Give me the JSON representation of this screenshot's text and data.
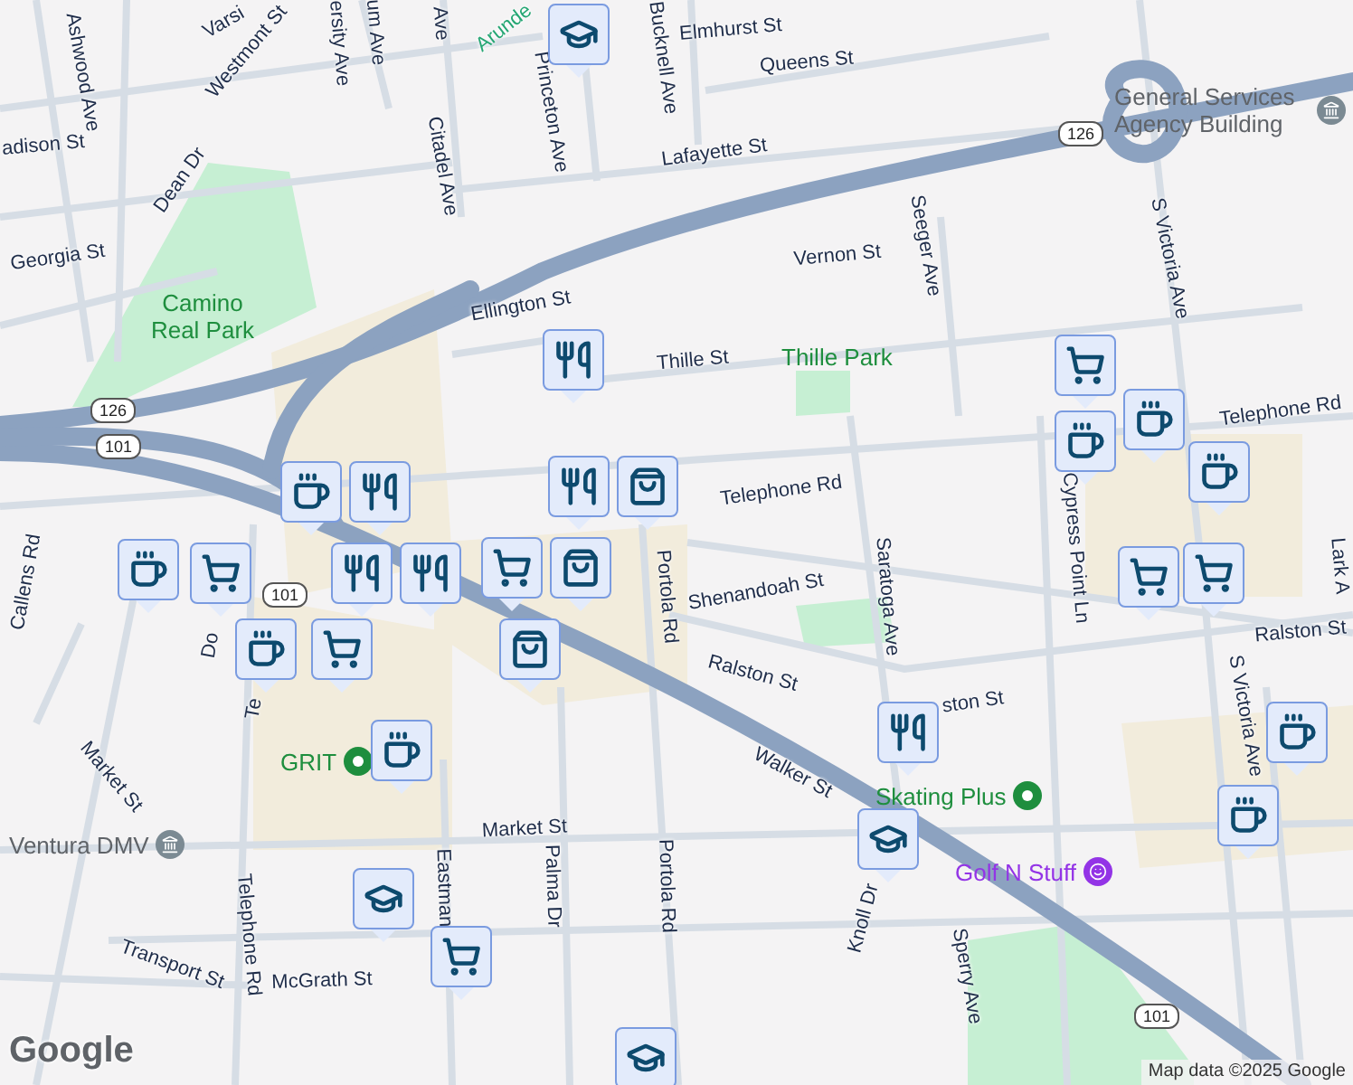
{
  "map": {
    "street_labels": [
      {
        "text": "Ashwood Ave",
        "kind": "street"
      },
      {
        "text": "Varsi",
        "kind": "street"
      },
      {
        "text": "Westmont St",
        "kind": "street"
      },
      {
        "text": "ersity Ave",
        "kind": "street"
      },
      {
        "text": "um Ave",
        "kind": "street"
      },
      {
        "text": "Ave",
        "kind": "street"
      },
      {
        "text": "Arunde",
        "kind": "trail"
      },
      {
        "text": "Princeton Ave",
        "kind": "street"
      },
      {
        "text": "Bucknell Ave",
        "kind": "street"
      },
      {
        "text": "Elmhurst St",
        "kind": "street"
      },
      {
        "text": "Queens St",
        "kind": "street"
      },
      {
        "text": "adison St",
        "kind": "street"
      },
      {
        "text": "Dean Dr",
        "kind": "street"
      },
      {
        "text": "Citadel Ave",
        "kind": "street"
      },
      {
        "text": "Lafayette St",
        "kind": "street"
      },
      {
        "text": "Georgia St",
        "kind": "street"
      },
      {
        "text": "Ellington St",
        "kind": "street"
      },
      {
        "text": "Thille St",
        "kind": "street"
      },
      {
        "text": "Vernon St",
        "kind": "street"
      },
      {
        "text": "Seeger Ave",
        "kind": "street"
      },
      {
        "text": "Telephone Rd",
        "kind": "street"
      },
      {
        "text": "Telephone Rd",
        "kind": "street"
      },
      {
        "text": "S Victoria Ave",
        "kind": "street"
      },
      {
        "text": "S Victoria Ave",
        "kind": "street"
      },
      {
        "text": "Cypress Point Ln",
        "kind": "street"
      },
      {
        "text": "Saratoga Ave",
        "kind": "street"
      },
      {
        "text": "Portola Rd",
        "kind": "street"
      },
      {
        "text": "Shenandoah St",
        "kind": "street"
      },
      {
        "text": "Ralston St",
        "kind": "street"
      },
      {
        "text": "ston St",
        "kind": "street"
      },
      {
        "text": "Ralston St",
        "kind": "street"
      },
      {
        "text": "Lark A",
        "kind": "street"
      },
      {
        "text": "Walker St",
        "kind": "street"
      },
      {
        "text": "Knoll Dr",
        "kind": "street"
      },
      {
        "text": "Sperry Ave",
        "kind": "street"
      },
      {
        "text": "Callens Rd",
        "kind": "street"
      },
      {
        "text": "Market St",
        "kind": "street"
      },
      {
        "text": "Market St",
        "kind": "street"
      },
      {
        "text": "Telephone Rd",
        "kind": "street"
      },
      {
        "text": "Te",
        "kind": "street"
      },
      {
        "text": "Do",
        "kind": "street"
      },
      {
        "text": "Eastman",
        "kind": "street"
      },
      {
        "text": "Palma Dr",
        "kind": "street"
      },
      {
        "text": "Portola Rd",
        "kind": "street"
      },
      {
        "text": "Transport St",
        "kind": "street"
      },
      {
        "text": "McGrath St",
        "kind": "street"
      }
    ],
    "places": [
      {
        "name": "Camino Real Park",
        "kind": "park"
      },
      {
        "name": "Thille Park",
        "kind": "park"
      },
      {
        "name": "General Services Agency Building",
        "kind": "civic"
      },
      {
        "name": "GRIT",
        "kind": "green-pin"
      },
      {
        "name": "Ventura DMV",
        "kind": "civic"
      },
      {
        "name": "Skating Plus",
        "kind": "green-pin"
      },
      {
        "name": "Golf N Stuff",
        "kind": "fun"
      }
    ],
    "highway_shields": [
      {
        "number": "126"
      },
      {
        "number": "101"
      },
      {
        "number": "101"
      },
      {
        "number": "126"
      },
      {
        "number": "101"
      }
    ],
    "markers": [
      {
        "kind": "school"
      },
      {
        "kind": "restaurant"
      },
      {
        "kind": "cafe"
      },
      {
        "kind": "restaurant"
      },
      {
        "kind": "cafe"
      },
      {
        "kind": "grocery"
      },
      {
        "kind": "cafe"
      },
      {
        "kind": "restaurant"
      },
      {
        "kind": "restaurant"
      },
      {
        "kind": "grocery"
      },
      {
        "kind": "restaurant"
      },
      {
        "kind": "shopping"
      },
      {
        "kind": "grocery"
      },
      {
        "kind": "shopping"
      },
      {
        "kind": "shopping"
      },
      {
        "kind": "cafe"
      },
      {
        "kind": "school"
      },
      {
        "kind": "grocery"
      },
      {
        "kind": "school"
      },
      {
        "kind": "restaurant"
      },
      {
        "kind": "school"
      },
      {
        "kind": "grocery"
      },
      {
        "kind": "cafe"
      },
      {
        "kind": "cafe"
      },
      {
        "kind": "cafe"
      },
      {
        "kind": "grocery"
      },
      {
        "kind": "grocery"
      },
      {
        "kind": "cafe"
      },
      {
        "kind": "cafe"
      }
    ],
    "logo": "Google",
    "attribution": "Map data ©2025 Google"
  }
}
